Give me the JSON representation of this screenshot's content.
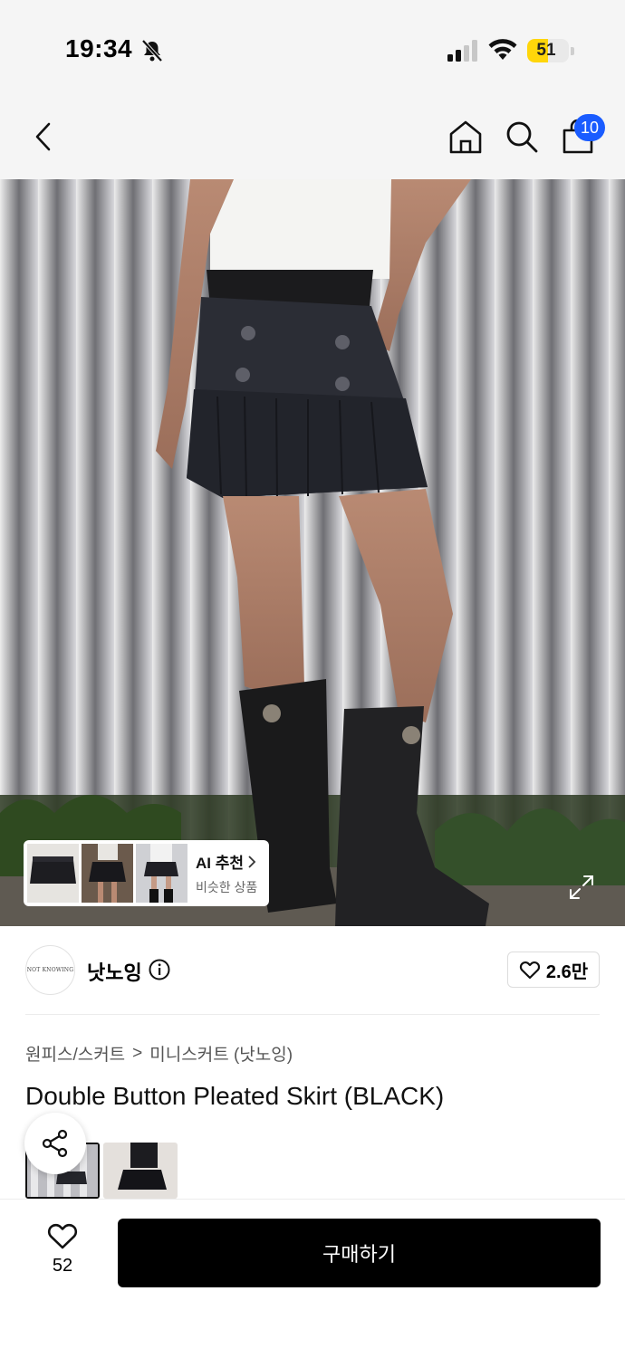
{
  "status_bar": {
    "time": "19:34",
    "battery": "51",
    "battery_level": 0.51,
    "icons": [
      "bell-slash-icon",
      "cellular-signal-icon",
      "wifi-icon",
      "battery-icon"
    ]
  },
  "nav": {
    "icons": [
      "back-icon",
      "home-icon",
      "search-icon",
      "shopping-bag-icon"
    ],
    "cart_count": "10"
  },
  "hero": {
    "ai_card": {
      "title": "AI 추천",
      "subtitle": "비슷한 상품"
    },
    "icons": [
      "expand-icon"
    ]
  },
  "brand": {
    "logo_text": "NOT KNOWING",
    "name": "낫노잉",
    "likes": "2.6만"
  },
  "breadcrumb": {
    "category": "원피스/스커트",
    "separator": ">",
    "subcategory": "미니스커트 (낫노잉)"
  },
  "product": {
    "title": "Double Button Pleated Skirt (BLACK)"
  },
  "bottom_bar": {
    "wish_count": "52",
    "buy_label": "구매하기"
  },
  "colors": {
    "accent_blue": "#1a5cff",
    "battery_yellow": "#ffd60a",
    "buy_button": "#000000"
  }
}
